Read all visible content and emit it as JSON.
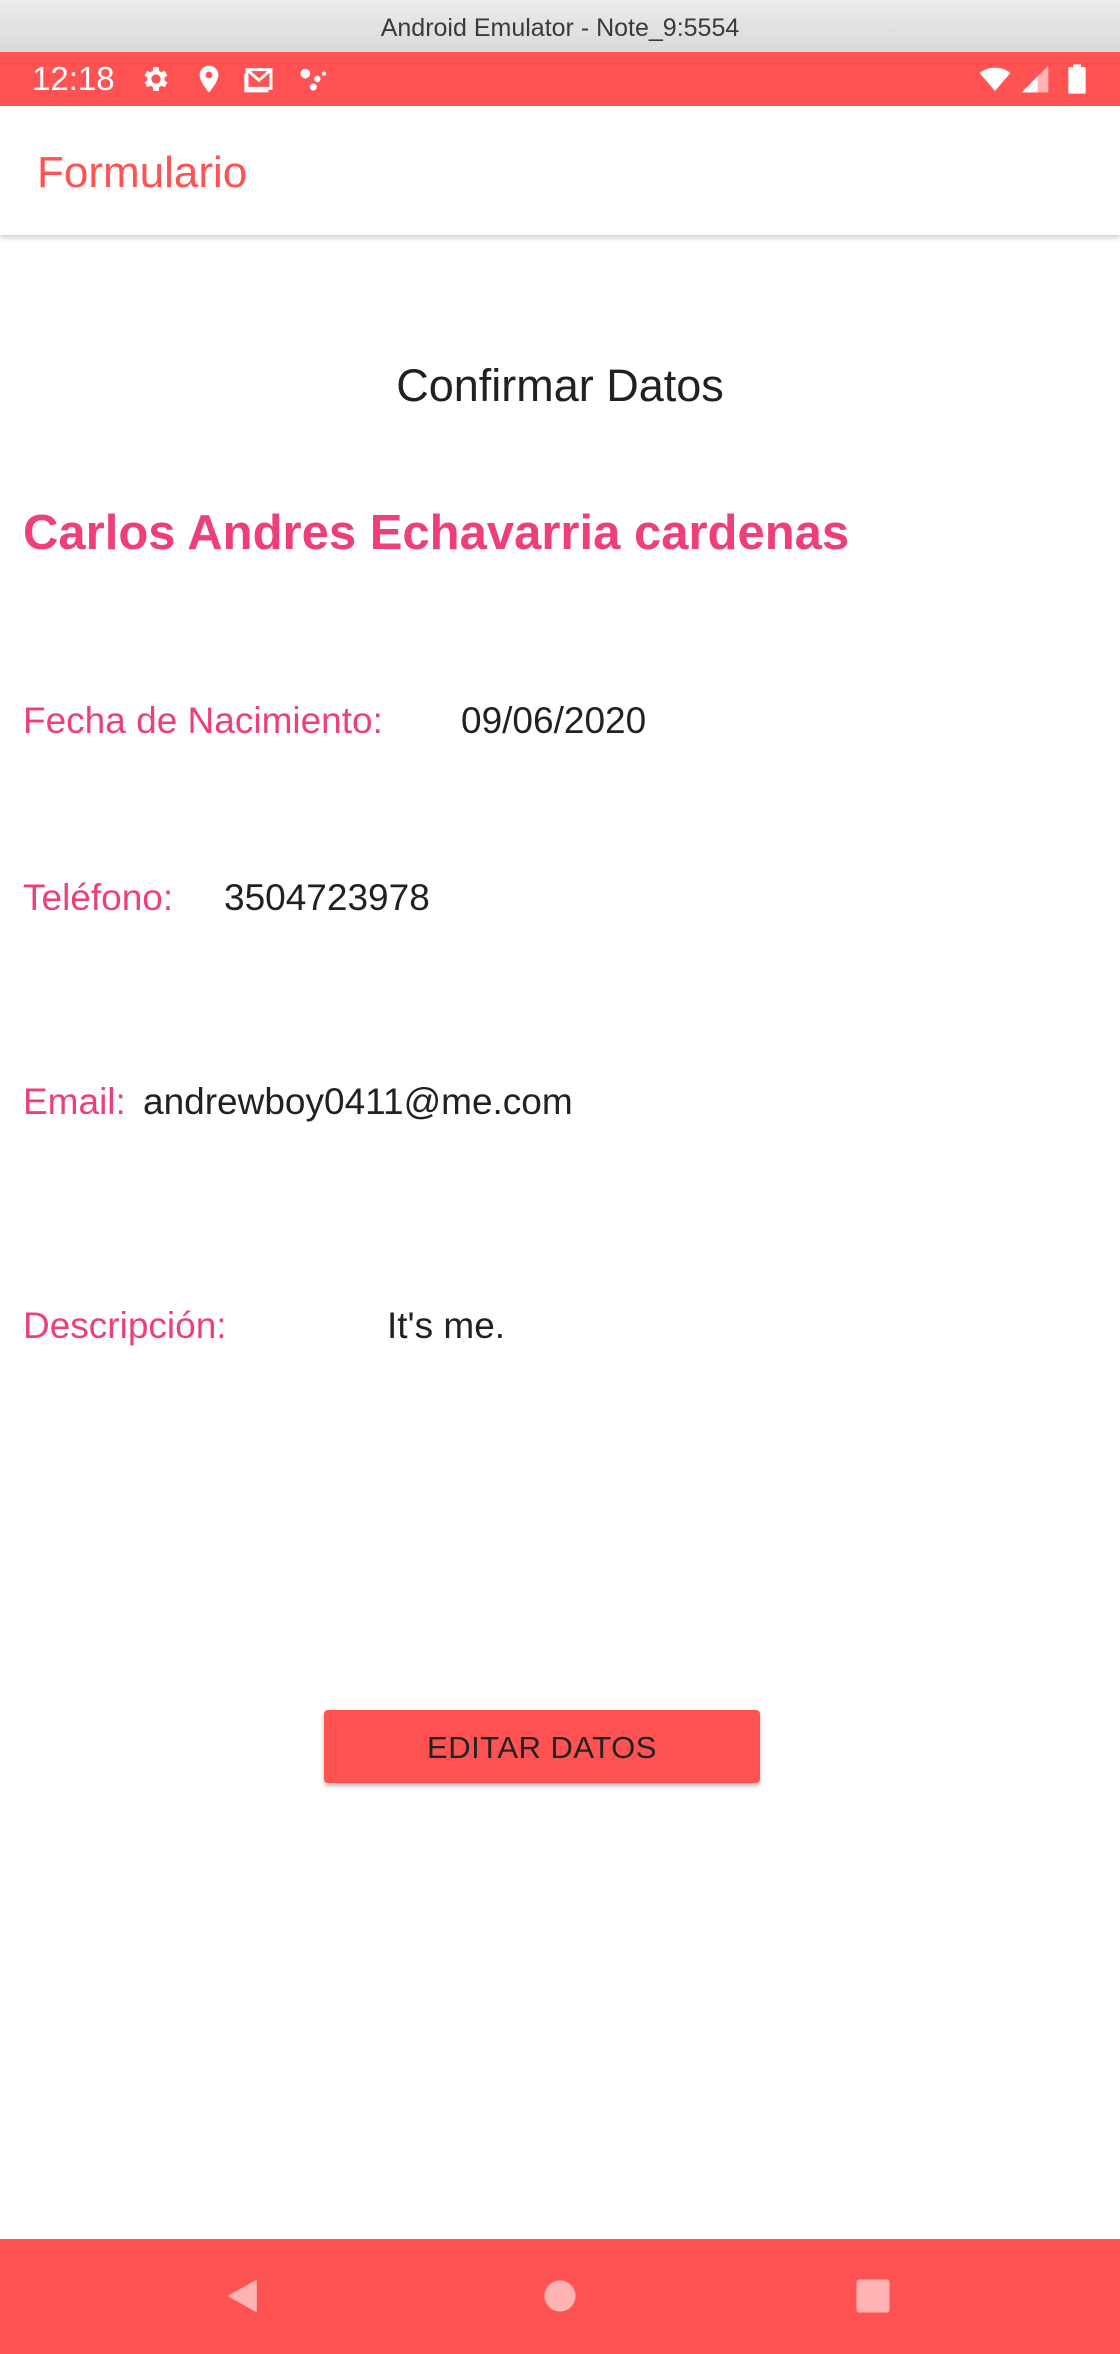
{
  "window": {
    "title": "Android Emulator - Note_9:5554"
  },
  "status_bar": {
    "time": "12:18",
    "icons_left": [
      "settings-icon",
      "location-icon",
      "gmail-icon",
      "assistant-icon"
    ],
    "icons_right": [
      "wifi-icon",
      "signal-icon",
      "battery-icon"
    ]
  },
  "app_bar": {
    "title": "Formulario"
  },
  "main": {
    "heading": "Confirmar Datos",
    "full_name": "Carlos Andres Echavarria cardenas",
    "fields": {
      "birth_date": {
        "label": "Fecha de Nacimiento:",
        "value": "09/06/2020"
      },
      "phone": {
        "label": "Teléfono:",
        "value": "3504723978"
      },
      "email": {
        "label": "Email:",
        "value": "andrewboy0411@me.com"
      },
      "description": {
        "label": "Descripción:",
        "value": "It's me."
      }
    },
    "edit_button_label": "EDITAR DATOS"
  },
  "nav_bar": {
    "buttons": [
      "back-icon",
      "home-icon",
      "recents-icon"
    ]
  },
  "colors": {
    "primary": "#ff5252",
    "accent": "#ef3f7a",
    "text": "#212121",
    "background": "#ffffff"
  }
}
